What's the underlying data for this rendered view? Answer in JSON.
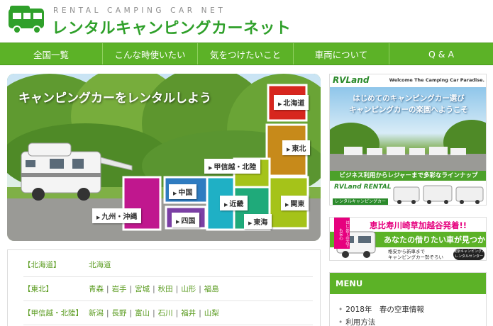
{
  "header": {
    "logo_sub": "RENTAL CAMPING CAR NET",
    "logo_main": "レンタルキャンピングカーネット"
  },
  "nav": {
    "items": [
      {
        "label": "全国一覧"
      },
      {
        "label": "こんな時使いたい"
      },
      {
        "label": "気をつけたいこと"
      },
      {
        "label": "車両について"
      },
      {
        "label": "Q & A"
      }
    ]
  },
  "hero": {
    "title": "キャンピングカーをレンタルしよう",
    "regions": [
      {
        "label": "北海道",
        "color": "#d7261e"
      },
      {
        "label": "東北",
        "color": "#c78a1a"
      },
      {
        "label": "甲信越・北陸",
        "color": "#a5c319"
      },
      {
        "label": "中国",
        "color": "#2f7cc1"
      },
      {
        "label": "近畿",
        "color": "#1fb0c5"
      },
      {
        "label": "関東",
        "color": "#a5c319"
      },
      {
        "label": "東海",
        "color": "#1faa7a"
      },
      {
        "label": "九州・沖縄",
        "color": "#c0178e"
      },
      {
        "label": "四国",
        "color": "#7b3fa5"
      }
    ]
  },
  "region_list": [
    {
      "name": "【北海道】",
      "prefs": [
        "北海道"
      ]
    },
    {
      "name": "【東北】",
      "prefs": [
        "青森",
        "岩手",
        "宮城",
        "秋田",
        "山形",
        "福島"
      ]
    },
    {
      "name": "【甲信越・北陸】",
      "prefs": [
        "新潟",
        "長野",
        "富山",
        "石川",
        "福井",
        "山梨"
      ]
    }
  ],
  "sidebar": {
    "rvland": {
      "logo": "RVLand",
      "welcome": "Welcome The Camping Car Paradise.",
      "headline1": "はじめてのキャンピングカー選び",
      "headline2": "キャンピングカーの楽園へようこそ",
      "tagline": "ビジネス利用からレジャーまで多彩なラインナップ",
      "rental_logo": "RVLand RENTAL",
      "rental_tag": "レンタルキャンピングカー"
    },
    "tokyo": {
      "ribbon": "はじめての方でも安心",
      "line1": "恵比寿川崎草加越谷発着!!",
      "line2": "あなたの借りたい車が見つかる!",
      "small1": "格安から新車まで",
      "small2": "キャンピングカー勢ぞろい",
      "badge1": "東京キャンピングカー",
      "badge2": "レンタルセンター"
    },
    "menu": {
      "title": "MENU",
      "items": [
        "2018年　春の空車情報",
        "利用方法"
      ]
    }
  },
  "colors": {
    "brand_green": "#5cb227",
    "logo_green": "#2fa02a",
    "link_green": "#5a9b1f"
  }
}
